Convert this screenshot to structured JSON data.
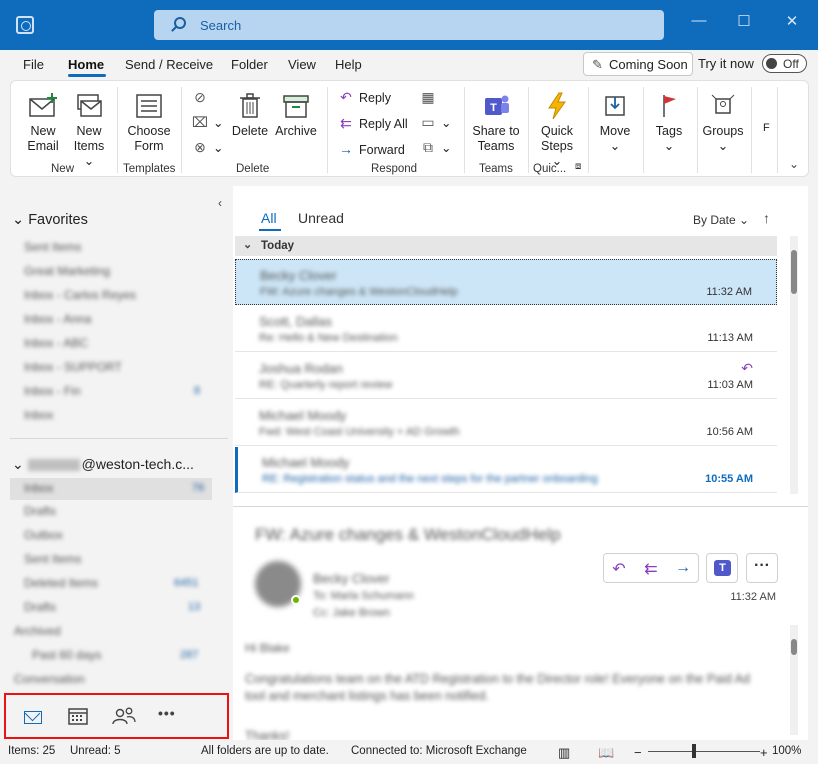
{
  "titlebar": {
    "search_placeholder": "Search",
    "minimize": "—",
    "maximize": "☐",
    "close": "✕"
  },
  "menu": {
    "tabs": [
      "File",
      "Home",
      "Send / Receive",
      "Folder",
      "View",
      "Help"
    ],
    "active": "Home",
    "coming_soon": "Coming Soon",
    "try_it_now": "Try it now",
    "toggle_state": "Off"
  },
  "ribbon": {
    "new_email": [
      "New",
      "Email"
    ],
    "new_items": [
      "New",
      "Items"
    ],
    "group_new": "New",
    "choose_form": [
      "Choose",
      "Form"
    ],
    "group_templates": "Templates",
    "delete": "Delete",
    "archive": "Archive",
    "group_delete": "Delete",
    "reply": "Reply",
    "reply_all": "Reply All",
    "forward": "Forward",
    "group_respond": "Respond",
    "share_to_teams": [
      "Share to",
      "Teams"
    ],
    "group_teams": "Teams",
    "quick_steps": [
      "Quick",
      "Steps"
    ],
    "group_quick": "Quic...",
    "move": "Move",
    "tags": "Tags",
    "groups": "Groups",
    "overflow": "F"
  },
  "nav": {
    "favorites_header": "Favorites",
    "favorites": [
      "Sent Items",
      "Great Marketing",
      "Inbox - Carlos Reyes",
      "Inbox - Anna",
      "Inbox - ABC",
      "Inbox - SUPPORT",
      "Inbox - Fin",
      "Inbox"
    ],
    "favorites_count_row6": "8",
    "account_suffix": "@weston-tech.c...",
    "folders": [
      {
        "label": "Inbox",
        "count": "76"
      },
      {
        "label": "Drafts",
        "count": ""
      },
      {
        "label": "Outbox",
        "count": ""
      },
      {
        "label": "Sent Items",
        "count": ""
      },
      {
        "label": "Deleted Items",
        "count": "6451"
      },
      {
        "label": "Drafts",
        "count": "13"
      },
      {
        "label": "Archived",
        "count": ""
      },
      {
        "label": "Past 60 days",
        "count": "287"
      },
      {
        "label": "Conversation",
        "count": ""
      }
    ],
    "bottom_nav": {
      "mail": "mail-icon",
      "calendar": "calendar-icon",
      "people": "people-icon",
      "more": "•••"
    }
  },
  "list": {
    "tabs": {
      "all": "All",
      "unread": "Unread"
    },
    "sort_label": "By Date",
    "sort_arrow": "↑",
    "group_header": "Today",
    "messages": [
      {
        "from": "Becky Clover",
        "subject": "FW: Azure changes & WestonCloudHelp",
        "time": "11:32 AM",
        "state": "selected"
      },
      {
        "from": "Scott, Dallas",
        "subject": "Re: Hello & New Destination",
        "time": "11:13 AM",
        "state": "read"
      },
      {
        "from": "Joshua Rodan",
        "subject": "RE: Quarterly report review",
        "time": "11:03 AM",
        "state": "replied"
      },
      {
        "from": "Michael Moody",
        "subject": "Fwd: West Coast University + AD Growth",
        "time": "10:56 AM",
        "state": "read"
      },
      {
        "from": "Michael Moody",
        "subject": "RE: Registration status and the next steps for the partner onboarding",
        "time": "10:55 AM",
        "state": "unread"
      }
    ]
  },
  "reading": {
    "subject": "FW: Azure changes & WestonCloudHelp",
    "from": "Becky Clover",
    "to": "To: Marla Schumann",
    "cc": "Cc: Jake Brown",
    "time": "11:32 AM",
    "greeting": "Hi Blake",
    "paragraph": "Congratulations team on the ATD Registration to the Director role! Everyone on the Paid Ad tool and merchant listings has been notified.",
    "paragraph2": "Thanks!"
  },
  "status": {
    "items": "Items: 25",
    "unread": "Unread: 5",
    "sync": "All folders are up to date.",
    "connection": "Connected to: Microsoft Exchange",
    "zoom": "100%"
  }
}
